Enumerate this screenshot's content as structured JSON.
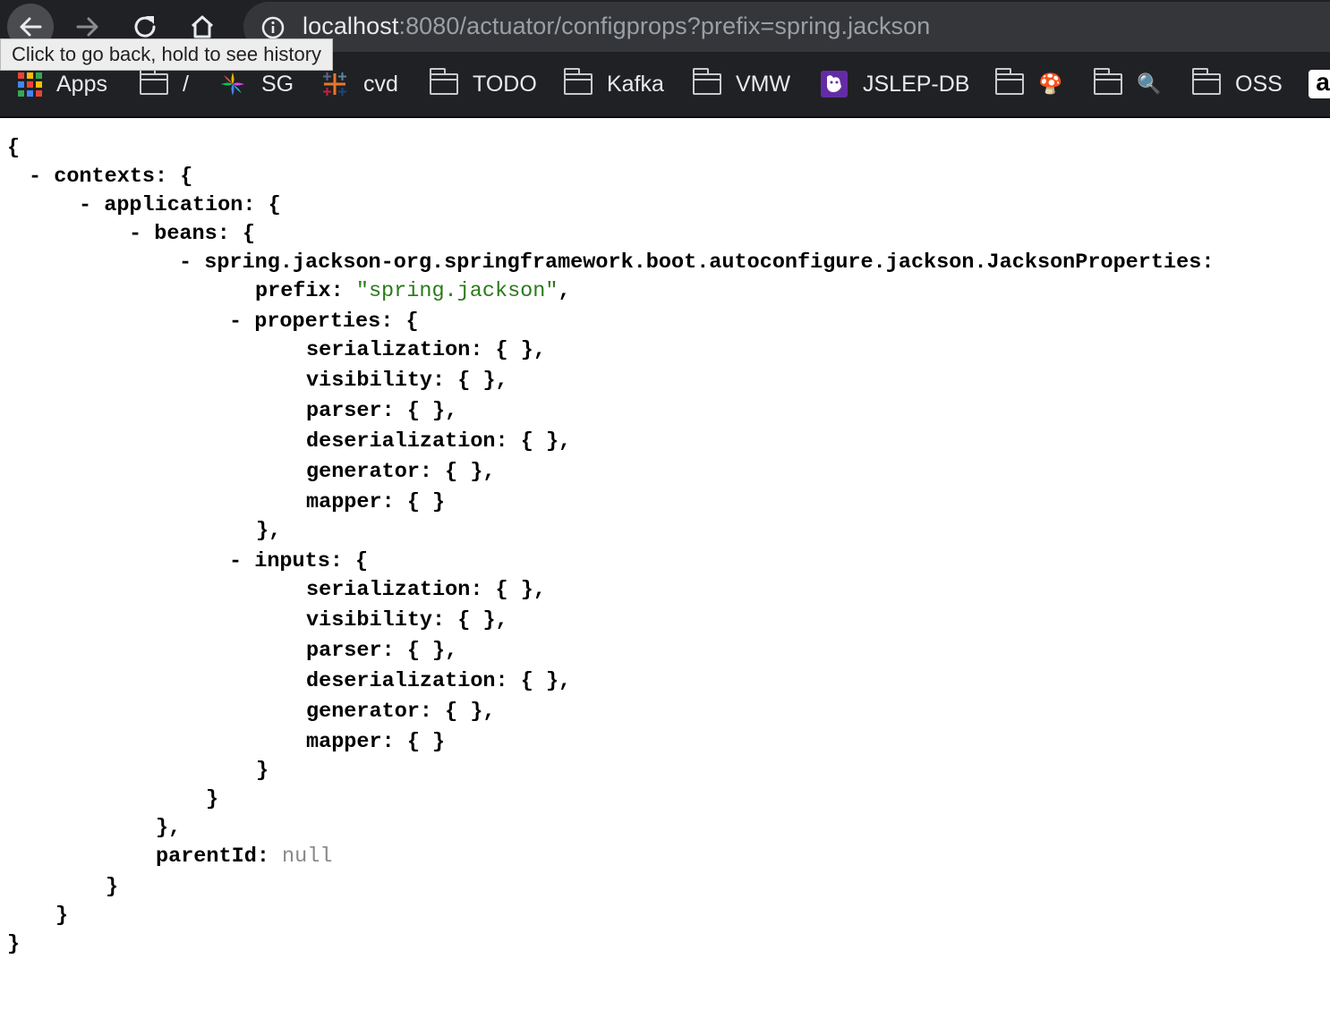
{
  "browser": {
    "url_host": "localhost",
    "url_rest": ":8080/actuator/configprops?prefix=spring.jackson",
    "back_tooltip": "Click to go back, hold to see history"
  },
  "bookmarks": [
    {
      "label": "Apps",
      "icon": "apps-grid-icon"
    },
    {
      "label": "/",
      "icon": "folder-icon"
    },
    {
      "label": "SG",
      "icon": "sg-colorful-icon"
    },
    {
      "label": "cvd",
      "icon": "tableau-icon"
    },
    {
      "label": "TODO",
      "icon": "folder-icon"
    },
    {
      "label": "Kafka",
      "icon": "folder-icon"
    },
    {
      "label": "VMW",
      "icon": "folder-icon"
    },
    {
      "label": "JSLEP-DB",
      "icon": "datadog-icon"
    },
    {
      "label": "🍄",
      "icon": "folder-icon"
    },
    {
      "label": "🔍",
      "icon": "folder-icon"
    },
    {
      "label": "OSS",
      "icon": "folder-icon"
    },
    {
      "label": "a",
      "icon": "amazon-icon"
    }
  ],
  "json": {
    "l1": "{",
    "l2_key": "contexts",
    "l3_key": "application",
    "l4_key": "beans",
    "l5_key": "spring.jackson-org.springframework.boot.autoconfigure.jackson.JacksonProperties",
    "l6_key": "prefix",
    "l6_val": "\"spring.jackson\"",
    "properties_key": "properties",
    "properties": [
      "serialization",
      "visibility",
      "parser",
      "deserialization",
      "generator",
      "mapper"
    ],
    "inputs_key": "inputs",
    "inputs": [
      "serialization",
      "visibility",
      "parser",
      "deserialization",
      "generator",
      "mapper"
    ],
    "parentId_key": "parentId",
    "parentId_val": "null",
    "collapse_marker": "-"
  }
}
